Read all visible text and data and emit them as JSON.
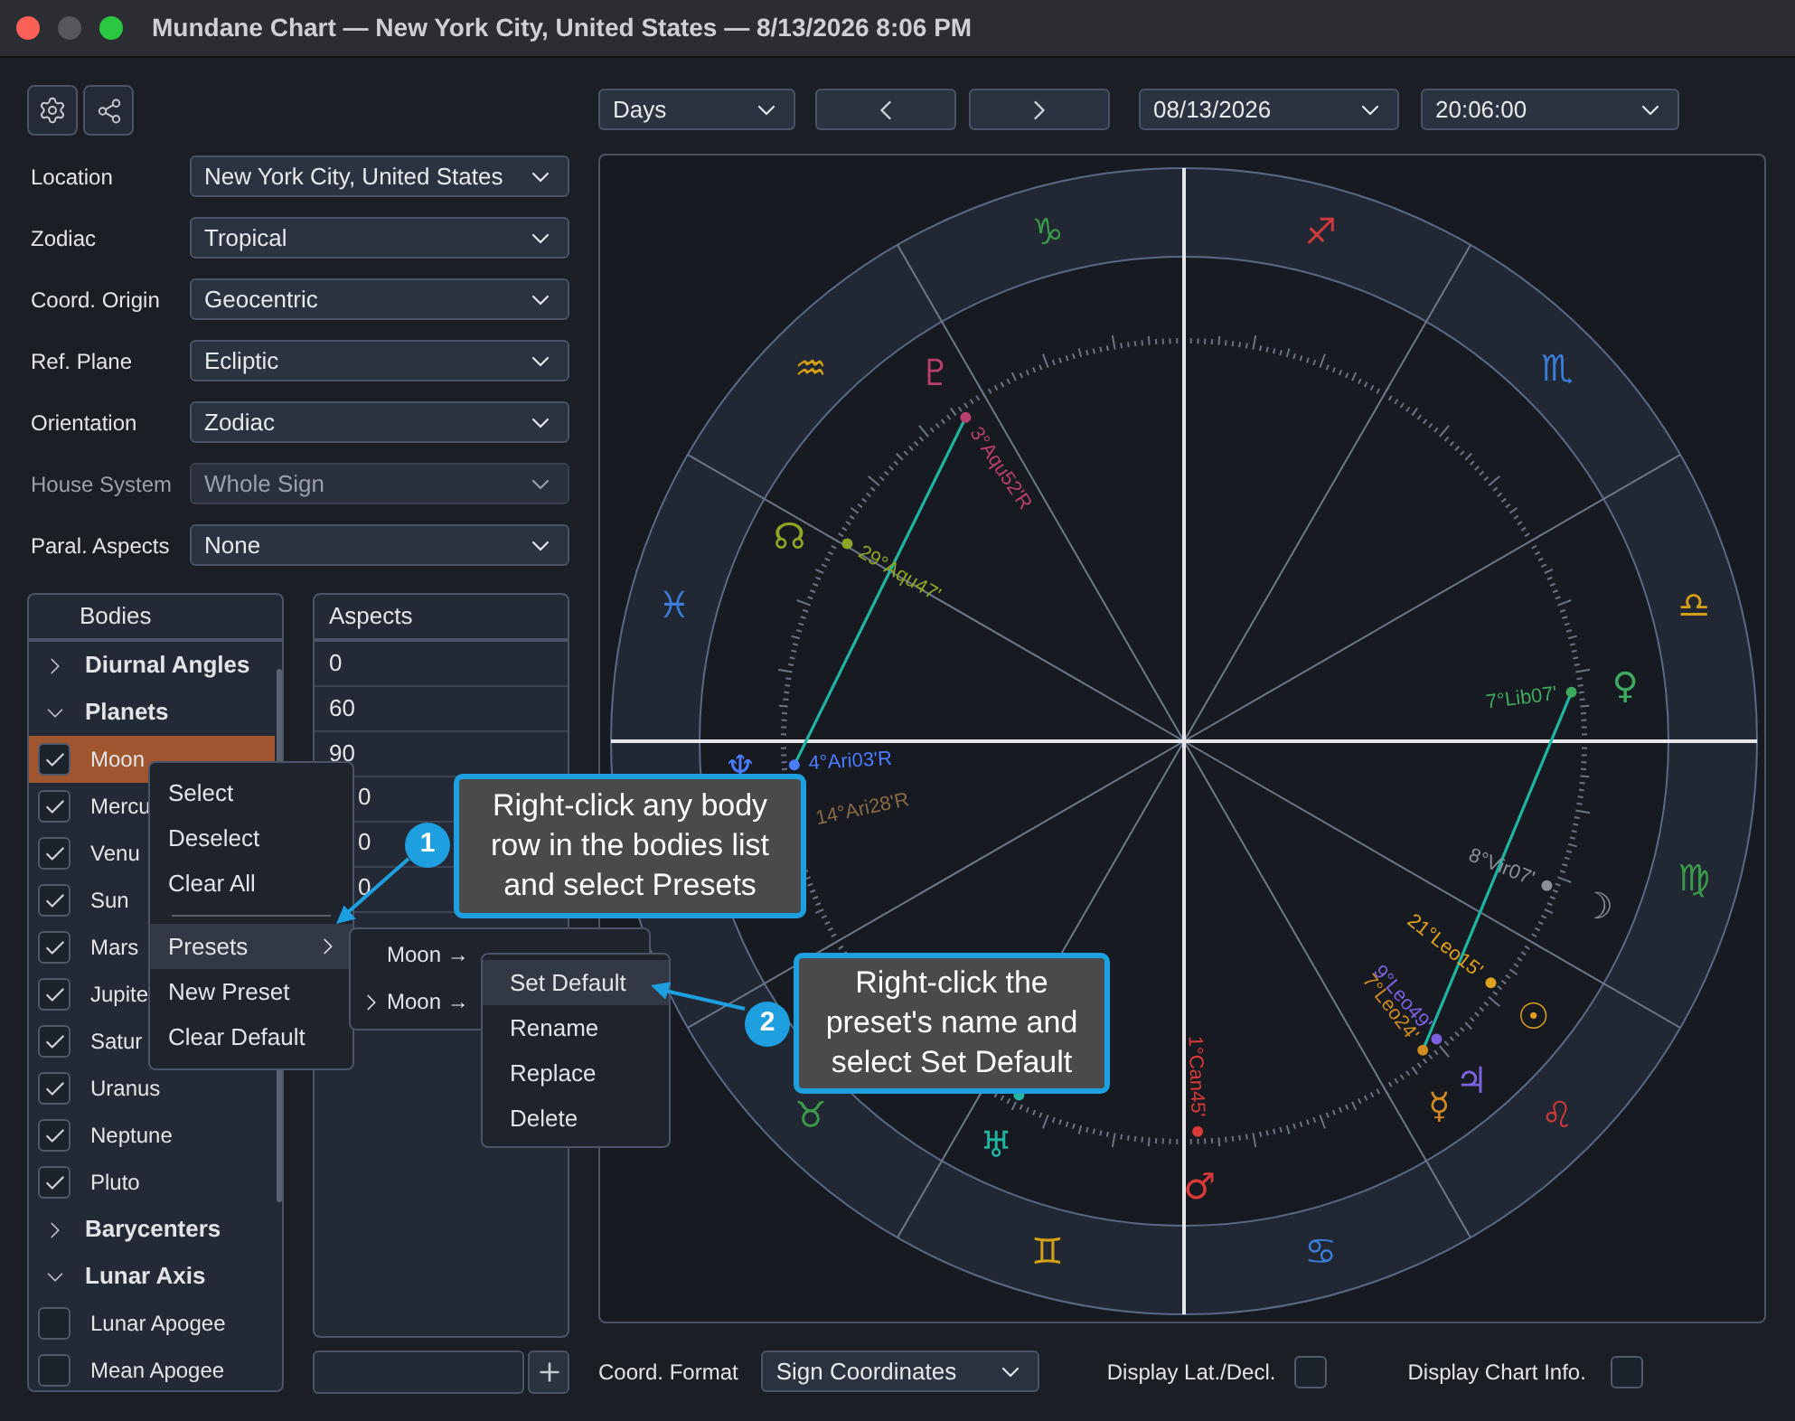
{
  "window": {
    "title": "Mundane Chart — New York City, United States — 8/13/2026 8:06 PM"
  },
  "settings": [
    {
      "label": "Location",
      "value": "New York City, United States",
      "disabled": false
    },
    {
      "label": "Zodiac",
      "value": "Tropical",
      "disabled": false
    },
    {
      "label": "Coord. Origin",
      "value": "Geocentric",
      "disabled": false
    },
    {
      "label": "Ref. Plane",
      "value": "Ecliptic",
      "disabled": false
    },
    {
      "label": "Orientation",
      "value": "Zodiac",
      "disabled": false
    },
    {
      "label": "House System",
      "value": "Whole Sign",
      "disabled": true
    },
    {
      "label": "Paral. Aspects",
      "value": "None",
      "disabled": false
    }
  ],
  "bodies": {
    "header": "Bodies",
    "items": [
      {
        "label": "Diurnal Angles",
        "expanded": false
      },
      {
        "label": "Planets",
        "expanded": true,
        "children": [
          {
            "label": "Moon",
            "checked": true,
            "selected": true
          },
          {
            "label": "Mercu",
            "checked": true,
            "selected": false
          },
          {
            "label": "Venu",
            "checked": true,
            "selected": false
          },
          {
            "label": "Sun",
            "checked": true,
            "selected": false
          },
          {
            "label": "Mars",
            "checked": true,
            "selected": false
          },
          {
            "label": "Jupite",
            "checked": true,
            "selected": false
          },
          {
            "label": "Satur",
            "checked": true,
            "selected": false
          },
          {
            "label": "Uranus",
            "checked": true,
            "selected": false
          },
          {
            "label": "Neptune",
            "checked": true,
            "selected": false
          },
          {
            "label": "Pluto",
            "checked": true,
            "selected": false
          }
        ]
      },
      {
        "label": "Barycenters",
        "expanded": false
      },
      {
        "label": "Lunar Axis",
        "expanded": true,
        "children": [
          {
            "label": "Lunar Apogee",
            "checked": false,
            "selected": false
          },
          {
            "label": "Mean Apogee",
            "checked": false,
            "selected": false
          }
        ]
      }
    ]
  },
  "aspects": {
    "header": "Aspects",
    "rows": [
      {
        "value": "0",
        "covered": false
      },
      {
        "value": "60",
        "covered": false
      },
      {
        "value": "90",
        "covered": false
      },
      {
        "value": "0",
        "covered": true
      },
      {
        "value": "0",
        "covered": true
      },
      {
        "value": "0",
        "covered": true
      }
    ]
  },
  "context_menu": [
    {
      "kind": "item",
      "label": "Select",
      "selected": false
    },
    {
      "kind": "item",
      "label": "Deselect",
      "selected": false
    },
    {
      "kind": "item",
      "label": "Clear All",
      "selected": false
    },
    {
      "kind": "separator"
    },
    {
      "kind": "submenu",
      "label": "Presets",
      "selected": true
    },
    {
      "kind": "item",
      "label": "New Preset",
      "selected": false
    },
    {
      "kind": "item",
      "label": "Clear Default",
      "selected": false
    }
  ],
  "presets_menu": [
    {
      "label": "Moon →",
      "expandable": false
    },
    {
      "label": "Moon →",
      "expandable": true
    }
  ],
  "preset_actions_menu": [
    {
      "label": "Set Default",
      "selected": true
    },
    {
      "label": "Rename",
      "selected": false
    },
    {
      "label": "Replace",
      "selected": false
    },
    {
      "label": "Delete",
      "selected": false
    }
  ],
  "callouts": [
    {
      "number": "1",
      "text": "Right-click any body row in the bodies list and select Presets"
    },
    {
      "number": "2",
      "text": "Right-click the preset's name and select Set Default"
    }
  ],
  "top_bar": {
    "interval": "Days",
    "date": "08/13/2026",
    "time": "20:06:00"
  },
  "chart": {
    "signs": [
      {
        "glyph": "♓",
        "color": "#3b7dd8"
      },
      {
        "glyph": "♒",
        "color": "#d4a017"
      },
      {
        "glyph": "♑",
        "color": "#3a9a4a"
      },
      {
        "glyph": "♐",
        "color": "#d03a3a"
      },
      {
        "glyph": "♏",
        "color": "#3b7dd8"
      },
      {
        "glyph": "♎",
        "color": "#d4a017"
      },
      {
        "glyph": "♍",
        "color": "#3a9a4a"
      },
      {
        "glyph": "♌",
        "color": "#d03a3a"
      },
      {
        "glyph": "♋",
        "color": "#3b7dd8"
      },
      {
        "glyph": "♊",
        "color": "#d4a017"
      },
      {
        "glyph": "♉",
        "color": "#3a9a4a"
      }
    ],
    "bodies": [
      {
        "glyph": "♇",
        "label": "3°Aqu52'R",
        "color": "#b8406e"
      },
      {
        "glyph": "☊",
        "label": "29°Aqu47'",
        "color": "#8fa526"
      },
      {
        "glyph": "♀",
        "label": "7°Lib07'",
        "color": "#3daa60"
      },
      {
        "glyph": "♆",
        "label": "4°Ari03'R",
        "color": "#4a7cff"
      },
      {
        "label": "14°Ari28'R",
        "color": "#8a6a45"
      },
      {
        "glyph": "☽",
        "label": "8°Vir07'",
        "color": "#8c9099"
      },
      {
        "glyph": "☉",
        "label": "21°Leo15'",
        "color": "#e0a020"
      },
      {
        "glyph": "♃",
        "label": "9°Leo49'",
        "color": "#7d62e0"
      },
      {
        "glyph": "☿",
        "label": "7°Leo24'",
        "color": "#d08a20"
      },
      {
        "glyph": "♂",
        "label": "1°Can45'",
        "color": "#d83a3a"
      },
      {
        "glyph": "♅",
        "color": "#1fb5a0"
      }
    ]
  },
  "footer": {
    "coord_format_label": "Coord. Format",
    "coord_format": "Sign Coordinates",
    "lat_decl_label": "Display Lat./Decl.",
    "lat_decl_checked": false,
    "chart_info_label": "Display Chart Info.",
    "chart_info_checked": false
  }
}
